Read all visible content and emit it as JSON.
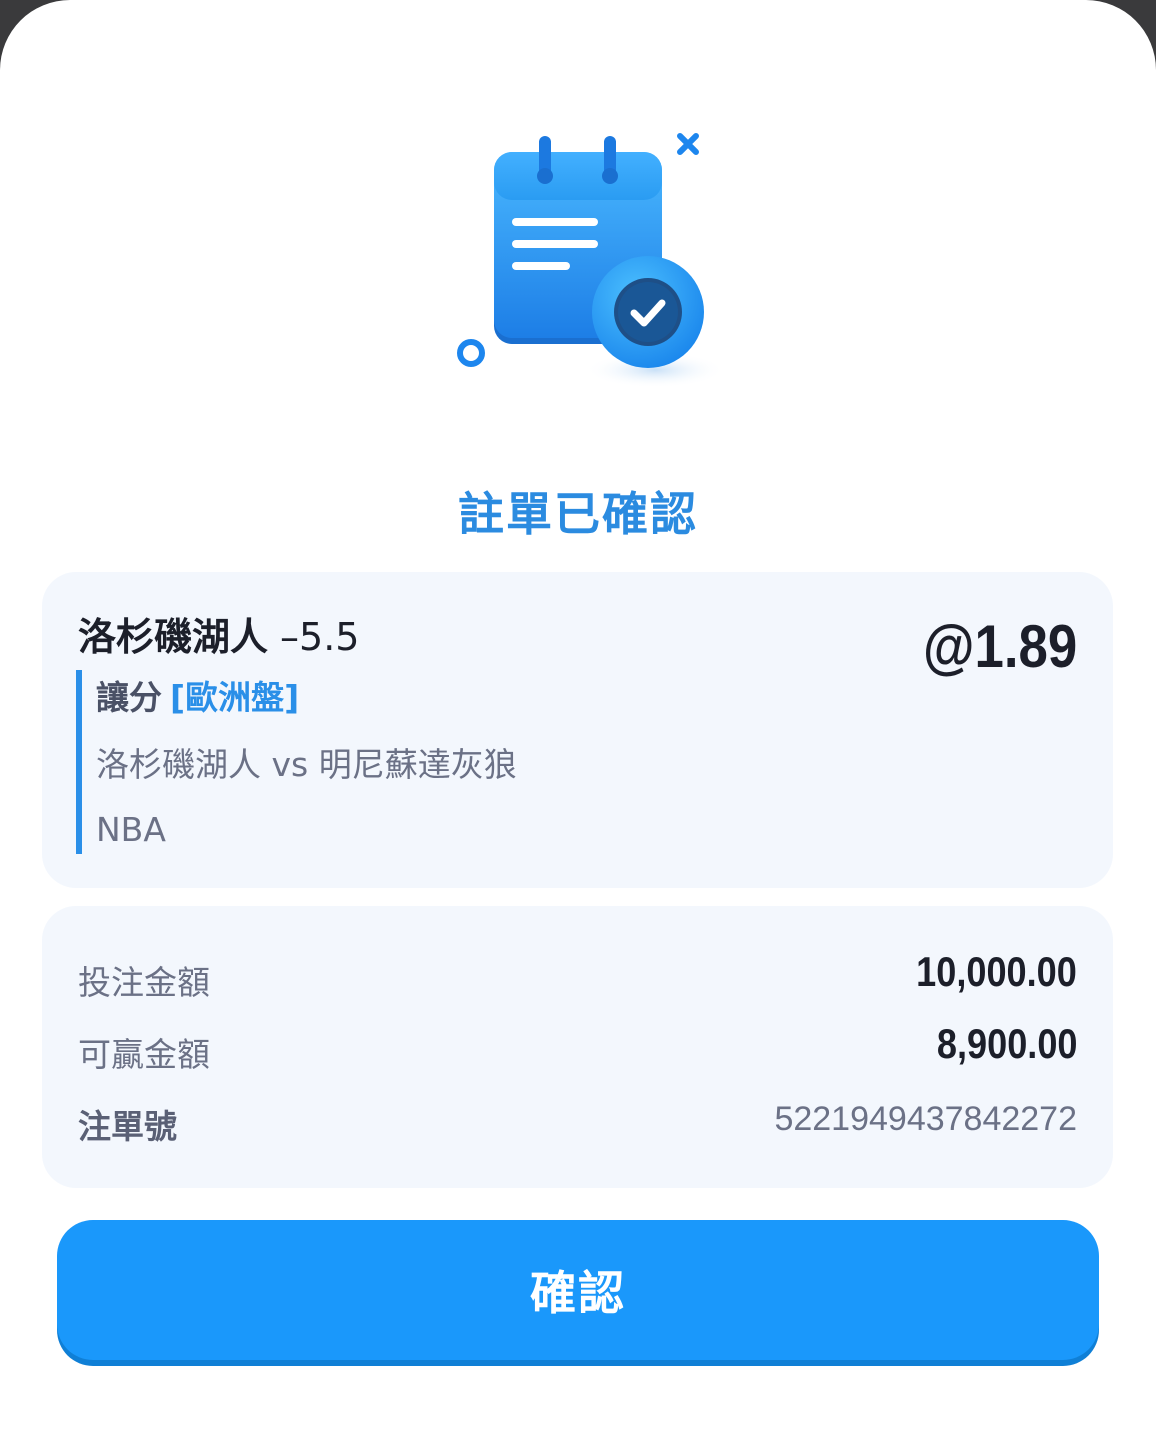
{
  "dialog": {
    "title": "註單已確認",
    "illustration_icon": "calendar-confirmed-icon"
  },
  "bet": {
    "team": "洛杉磯湖人",
    "line": "–5.5",
    "odds": "@1.89",
    "market": "讓分",
    "market_type": "[歐洲盤]",
    "matchup": "洛杉磯湖人 vs 明尼蘇達灰狼",
    "league": "NBA"
  },
  "summary": {
    "stake_label": "投注金額",
    "stake_value": "10,000.00",
    "win_label": "可贏金額",
    "win_value": "8,900.00",
    "ticket_label": "注單號",
    "ticket_value": "5221949437842272"
  },
  "actions": {
    "confirm_label": "確認"
  },
  "colors": {
    "accent": "#1a98fb",
    "title": "#2b8be0",
    "card_bg": "#f3f7fd"
  }
}
